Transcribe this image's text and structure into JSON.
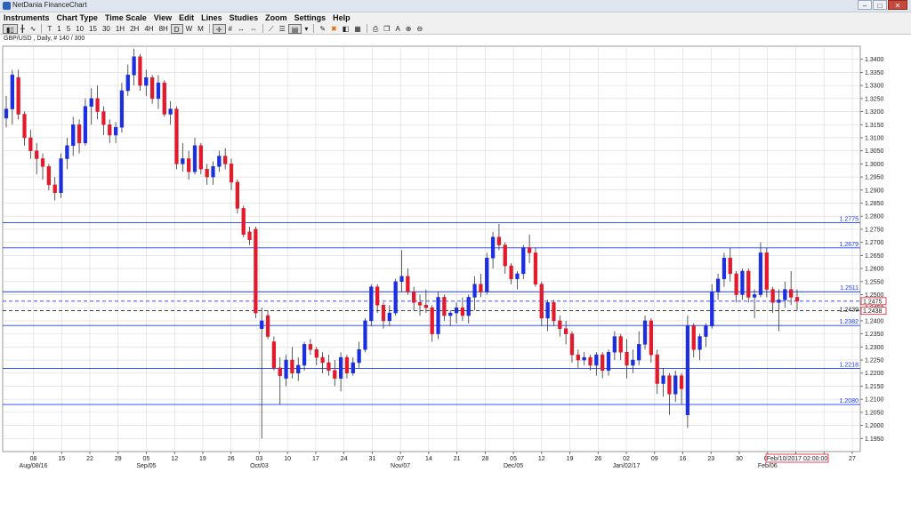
{
  "window": {
    "title": "NetDania FinanceChart",
    "buttons": [
      "–",
      "□",
      "✕"
    ]
  },
  "menu": [
    "Instruments",
    "Chart Type",
    "Time Scale",
    "View",
    "Edit",
    "Lines",
    "Studies",
    "Zoom",
    "Settings",
    "Help"
  ],
  "toolbar": {
    "timeframes": [
      "T",
      "1",
      "5",
      "10",
      "15",
      "30",
      "1H",
      "2H",
      "4H",
      "8H",
      "D",
      "W",
      "M"
    ],
    "active_timeframe": "D",
    "icons": [
      "candles-icon",
      "bars-icon",
      "line-icon",
      "crosshair-icon",
      "grid-icon",
      "scroll-icon",
      "compress-icon",
      "trendline-icon",
      "fibonacci-icon",
      "channel-icon",
      "draw-icon",
      "delete-icon",
      "color-icon",
      "properties-icon",
      "print-icon",
      "copy-icon",
      "text-icon",
      "zoom-in-icon",
      "zoom-out-icon"
    ]
  },
  "symbol_info": "GBP/USD , Daily, # 140 / 300",
  "colors": {
    "up": "#1c2fe0",
    "down": "#e21a2b",
    "level": "#1a3bff",
    "grid": "#d9d9d9"
  },
  "chart_data": {
    "type": "candlestick",
    "ylim": [
      1.19,
      1.345
    ],
    "y_ticks": [
      "1.3400",
      "1.3350",
      "1.3300",
      "1.3250",
      "1.3200",
      "1.3150",
      "1.3100",
      "1.3050",
      "1.3000",
      "1.2950",
      "1.2900",
      "1.2850",
      "1.2800",
      "1.2750",
      "1.2700",
      "1.2650",
      "1.2600",
      "1.2550",
      "1.2500",
      "1.2450",
      "1.2400",
      "1.2350",
      "1.2300",
      "1.2250",
      "1.2200",
      "1.2150",
      "1.2100",
      "1.2050",
      "1.2000",
      "1.1950"
    ],
    "x_ticks": [
      "08",
      "15",
      "22",
      "29",
      "05",
      "12",
      "19",
      "26",
      "03",
      "10",
      "17",
      "24",
      "31",
      "07",
      "14",
      "21",
      "28",
      "05",
      "12",
      "19",
      "26",
      "02",
      "09",
      "16",
      "23",
      "30",
      "06",
      "13",
      "20",
      "27"
    ],
    "x_month_labels": [
      {
        "index": 0,
        "label": "Aug/08/16"
      },
      {
        "index": 4,
        "label": "Sep/05"
      },
      {
        "index": 8,
        "label": "Oct/03"
      },
      {
        "index": 13,
        "label": "Nov/07"
      },
      {
        "index": 17,
        "label": "Dec/05"
      },
      {
        "index": 21,
        "label": "Jan/02/17"
      },
      {
        "index": 26,
        "label": "Feb/06"
      }
    ],
    "levels": [
      {
        "value": 1.2775,
        "label": "1.2775",
        "style": "solid"
      },
      {
        "value": 1.2679,
        "label": "1.2679",
        "style": "solid"
      },
      {
        "value": 1.2511,
        "label": "1.2511",
        "style": "solid"
      },
      {
        "value": 1.2382,
        "label": "1.2382",
        "style": "solid"
      },
      {
        "value": 1.2218,
        "label": "1.2218",
        "style": "solid"
      },
      {
        "value": 1.208,
        "label": "1.2080",
        "style": "solid"
      },
      {
        "value": 1.2475,
        "label": "1.2475",
        "style": "dashed-blue"
      },
      {
        "value": 1.2439,
        "label": "1.2439",
        "style": "dashed-black"
      }
    ],
    "price_tags": [
      {
        "value": 1.2475,
        "label": "1.2475"
      },
      {
        "value": 1.2438,
        "label": "1.2438"
      }
    ],
    "date_tag": "Feb/10/2017 02:00:00",
    "candles": [
      [
        1.3175,
        1.326,
        1.314,
        1.321
      ],
      [
        1.321,
        1.336,
        1.315,
        1.334
      ],
      [
        1.333,
        1.336,
        1.317,
        1.319
      ],
      [
        1.319,
        1.32,
        1.307,
        1.31
      ],
      [
        1.31,
        1.313,
        1.302,
        1.305
      ],
      [
        1.305,
        1.308,
        1.296,
        1.302
      ],
      [
        1.302,
        1.304,
        1.294,
        1.299
      ],
      [
        1.299,
        1.3,
        1.29,
        1.292
      ],
      [
        1.292,
        1.295,
        1.286,
        1.289
      ],
      [
        1.289,
        1.304,
        1.287,
        1.302
      ],
      [
        1.302,
        1.31,
        1.298,
        1.307
      ],
      [
        1.307,
        1.318,
        1.303,
        1.315
      ],
      [
        1.315,
        1.317,
        1.304,
        1.308
      ],
      [
        1.308,
        1.325,
        1.307,
        1.322
      ],
      [
        1.322,
        1.329,
        1.315,
        1.325
      ],
      [
        1.325,
        1.33,
        1.317,
        1.32
      ],
      [
        1.32,
        1.322,
        1.311,
        1.315
      ],
      [
        1.315,
        1.317,
        1.308,
        1.311
      ],
      [
        1.311,
        1.316,
        1.308,
        1.314
      ],
      [
        1.314,
        1.331,
        1.312,
        1.328
      ],
      [
        1.328,
        1.338,
        1.326,
        1.334
      ],
      [
        1.334,
        1.344,
        1.33,
        1.341
      ],
      [
        1.341,
        1.342,
        1.328,
        1.33
      ],
      [
        1.33,
        1.336,
        1.326,
        1.333
      ],
      [
        1.333,
        1.334,
        1.323,
        1.325
      ],
      [
        1.325,
        1.334,
        1.321,
        1.331
      ],
      [
        1.331,
        1.332,
        1.318,
        1.319
      ],
      [
        1.319,
        1.324,
        1.315,
        1.321
      ],
      [
        1.321,
        1.322,
        1.298,
        1.3
      ],
      [
        1.3,
        1.308,
        1.297,
        1.302
      ],
      [
        1.302,
        1.305,
        1.294,
        1.297
      ],
      [
        1.297,
        1.31,
        1.296,
        1.307
      ],
      [
        1.307,
        1.308,
        1.296,
        1.298
      ],
      [
        1.298,
        1.3,
        1.292,
        1.295
      ],
      [
        1.295,
        1.301,
        1.292,
        1.299
      ],
      [
        1.299,
        1.305,
        1.297,
        1.303
      ],
      [
        1.303,
        1.306,
        1.298,
        1.3
      ],
      [
        1.3,
        1.302,
        1.29,
        1.293
      ],
      [
        1.293,
        1.294,
        1.281,
        1.283
      ],
      [
        1.283,
        1.284,
        1.272,
        1.273
      ],
      [
        1.274,
        1.276,
        1.269,
        1.271
      ],
      [
        1.275,
        1.276,
        1.241,
        1.243
      ],
      [
        1.237,
        1.245,
        1.195,
        1.24
      ],
      [
        1.242,
        1.244,
        1.233,
        1.234
      ],
      [
        1.232,
        1.234,
        1.221,
        1.222
      ],
      [
        1.222,
        1.226,
        1.208,
        1.219
      ],
      [
        1.218,
        1.227,
        1.215,
        1.225
      ],
      [
        1.225,
        1.23,
        1.218,
        1.22
      ],
      [
        1.22,
        1.226,
        1.217,
        1.223
      ],
      [
        1.223,
        1.232,
        1.221,
        1.231
      ],
      [
        1.231,
        1.233,
        1.227,
        1.229
      ],
      [
        1.229,
        1.23,
        1.223,
        1.226
      ],
      [
        1.226,
        1.228,
        1.22,
        1.224
      ],
      [
        1.224,
        1.227,
        1.219,
        1.221
      ],
      [
        1.221,
        1.225,
        1.215,
        1.218
      ],
      [
        1.218,
        1.228,
        1.213,
        1.226
      ],
      [
        1.226,
        1.227,
        1.218,
        1.22
      ],
      [
        1.22,
        1.226,
        1.219,
        1.224
      ],
      [
        1.224,
        1.232,
        1.222,
        1.229
      ],
      [
        1.229,
        1.241,
        1.228,
        1.24
      ],
      [
        1.24,
        1.254,
        1.238,
        1.253
      ],
      [
        1.253,
        1.254,
        1.243,
        1.246
      ],
      [
        1.246,
        1.247,
        1.237,
        1.24
      ],
      [
        1.24,
        1.246,
        1.238,
        1.243
      ],
      [
        1.243,
        1.256,
        1.242,
        1.255
      ],
      [
        1.255,
        1.267,
        1.251,
        1.257
      ],
      [
        1.257,
        1.26,
        1.25,
        1.251
      ],
      [
        1.251,
        1.253,
        1.244,
        1.247
      ],
      [
        1.247,
        1.25,
        1.242,
        1.246
      ],
      [
        1.246,
        1.252,
        1.243,
        1.245
      ],
      [
        1.245,
        1.246,
        1.232,
        1.235
      ],
      [
        1.235,
        1.251,
        1.233,
        1.249
      ],
      [
        1.249,
        1.25,
        1.24,
        1.242
      ],
      [
        1.242,
        1.244,
        1.238,
        1.243
      ],
      [
        1.243,
        1.247,
        1.239,
        1.245
      ],
      [
        1.245,
        1.249,
        1.24,
        1.242
      ],
      [
        1.242,
        1.25,
        1.239,
        1.249
      ],
      [
        1.249,
        1.257,
        1.244,
        1.254
      ],
      [
        1.254,
        1.258,
        1.249,
        1.251
      ],
      [
        1.251,
        1.266,
        1.25,
        1.264
      ],
      [
        1.264,
        1.274,
        1.26,
        1.272
      ],
      [
        1.272,
        1.277,
        1.267,
        1.269
      ],
      [
        1.269,
        1.27,
        1.258,
        1.261
      ],
      [
        1.261,
        1.262,
        1.254,
        1.256
      ],
      [
        1.256,
        1.259,
        1.252,
        1.258
      ],
      [
        1.258,
        1.269,
        1.256,
        1.268
      ],
      [
        1.268,
        1.273,
        1.262,
        1.266
      ],
      [
        1.266,
        1.268,
        1.253,
        1.254
      ],
      [
        1.254,
        1.255,
        1.238,
        1.241
      ],
      [
        1.241,
        1.248,
        1.236,
        1.247
      ],
      [
        1.247,
        1.248,
        1.238,
        1.24
      ],
      [
        1.24,
        1.242,
        1.234,
        1.237
      ],
      [
        1.237,
        1.24,
        1.231,
        1.235
      ],
      [
        1.235,
        1.236,
        1.224,
        1.227
      ],
      [
        1.227,
        1.229,
        1.222,
        1.225
      ],
      [
        1.225,
        1.228,
        1.223,
        1.226
      ],
      [
        1.226,
        1.227,
        1.221,
        1.223
      ],
      [
        1.223,
        1.228,
        1.219,
        1.227
      ],
      [
        1.227,
        1.228,
        1.218,
        1.221
      ],
      [
        1.221,
        1.229,
        1.219,
        1.228
      ],
      [
        1.228,
        1.236,
        1.225,
        1.234
      ],
      [
        1.234,
        1.235,
        1.225,
        1.228
      ],
      [
        1.228,
        1.233,
        1.218,
        1.223
      ],
      [
        1.223,
        1.229,
        1.22,
        1.225
      ],
      [
        1.225,
        1.236,
        1.223,
        1.231
      ],
      [
        1.231,
        1.242,
        1.229,
        1.24
      ],
      [
        1.24,
        1.241,
        1.224,
        1.227
      ],
      [
        1.227,
        1.229,
        1.212,
        1.216
      ],
      [
        1.216,
        1.222,
        1.211,
        1.219
      ],
      [
        1.219,
        1.22,
        1.204,
        1.212
      ],
      [
        1.212,
        1.221,
        1.209,
        1.219
      ],
      [
        1.219,
        1.22,
        1.208,
        1.214
      ],
      [
        1.204,
        1.242,
        1.199,
        1.238
      ],
      [
        1.238,
        1.239,
        1.226,
        1.229
      ],
      [
        1.229,
        1.235,
        1.225,
        1.234
      ],
      [
        1.234,
        1.239,
        1.23,
        1.238
      ],
      [
        1.238,
        1.254,
        1.237,
        1.251
      ],
      [
        1.251,
        1.258,
        1.248,
        1.256
      ],
      [
        1.256,
        1.266,
        1.253,
        1.264
      ],
      [
        1.264,
        1.268,
        1.255,
        1.258
      ],
      [
        1.258,
        1.259,
        1.247,
        1.25
      ],
      [
        1.25,
        1.26,
        1.248,
        1.259
      ],
      [
        1.259,
        1.26,
        1.247,
        1.249
      ],
      [
        1.249,
        1.252,
        1.241,
        1.25
      ],
      [
        1.25,
        1.27,
        1.249,
        1.266
      ],
      [
        1.266,
        1.268,
        1.249,
        1.252
      ],
      [
        1.252,
        1.253,
        1.243,
        1.247
      ],
      [
        1.247,
        1.252,
        1.236,
        1.248
      ],
      [
        1.248,
        1.255,
        1.245,
        1.252
      ],
      [
        1.252,
        1.259,
        1.246,
        1.249
      ],
      [
        1.249,
        1.252,
        1.244,
        1.2475
      ]
    ]
  }
}
